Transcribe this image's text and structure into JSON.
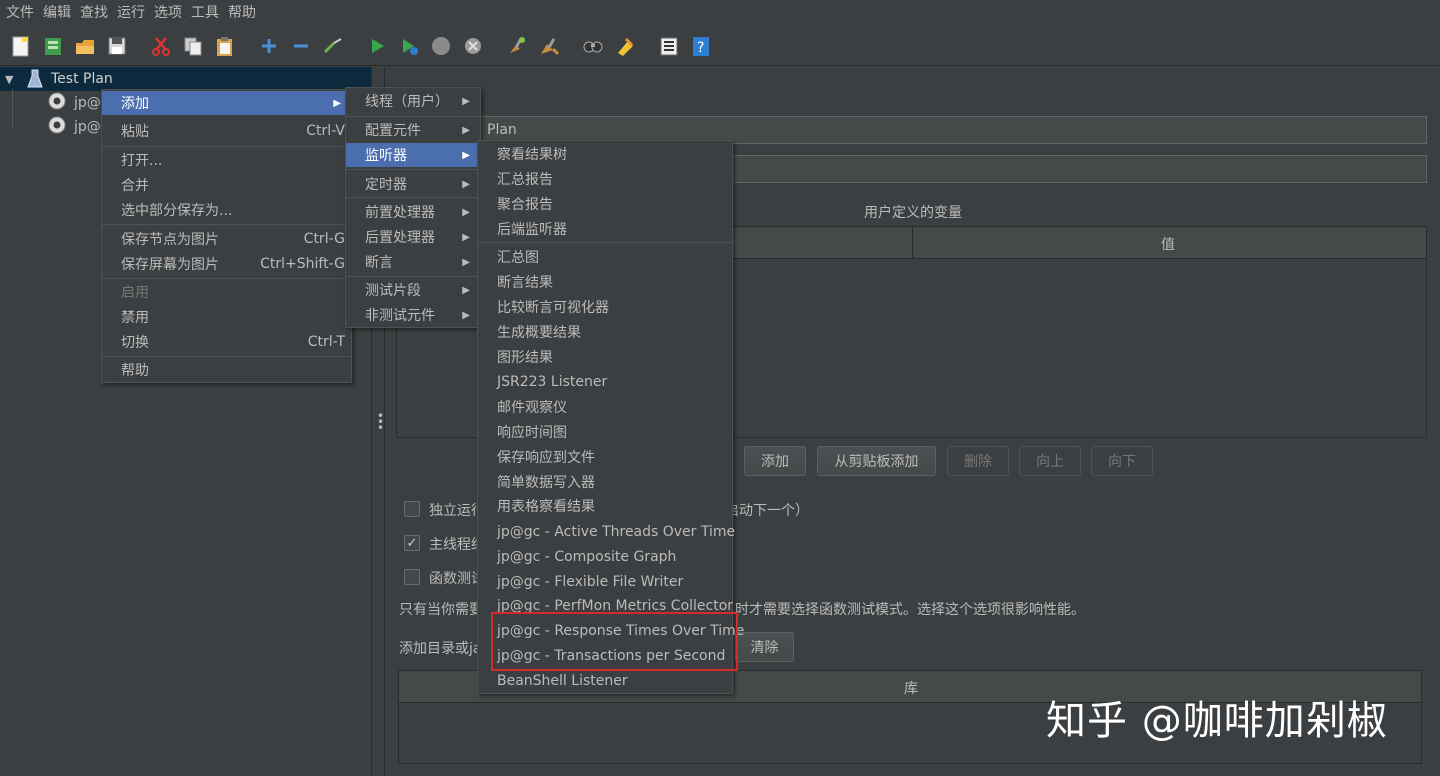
{
  "menubar": [
    "文件",
    "编辑",
    "查找",
    "运行",
    "选项",
    "工具",
    "帮助"
  ],
  "toolbar_icons": [
    "new-icon",
    "templates-icon",
    "open-icon",
    "save-icon",
    "cut-icon",
    "copy-icon",
    "paste-icon",
    "expand-icon",
    "collapse-icon",
    "toggle-icon",
    "start-icon",
    "start-no-pause-icon",
    "stop-icon",
    "shutdown-icon",
    "clear-icon",
    "clear-all-icon",
    "search-icon",
    "reset-search-icon",
    "function-helper-icon",
    "help-icon"
  ],
  "tree": {
    "root": "Test Plan",
    "children": [
      "jp@",
      "jp@"
    ]
  },
  "context_menu": {
    "items": [
      {
        "label": "添加",
        "shortcut": ""
      },
      {
        "label": "粘贴",
        "shortcut": "Ctrl-V"
      },
      {
        "label": "打开...",
        "shortcut": ""
      },
      {
        "label": "合并",
        "shortcut": ""
      },
      {
        "label": "选中部分保存为...",
        "shortcut": ""
      },
      {
        "label": "保存节点为图片",
        "shortcut": "Ctrl-G"
      },
      {
        "label": "保存屏幕为图片",
        "shortcut": "Ctrl+Shift-G"
      },
      {
        "label": "启用",
        "shortcut": ""
      },
      {
        "label": "禁用",
        "shortcut": ""
      },
      {
        "label": "切换",
        "shortcut": "Ctrl-T"
      },
      {
        "label": "帮助",
        "shortcut": ""
      }
    ]
  },
  "add_submenu": {
    "items": [
      "线程（用户）",
      "配置元件",
      "监听器",
      "定时器",
      "前置处理器",
      "后置处理器",
      "断言",
      "测试片段",
      "非测试元件"
    ]
  },
  "listener_submenu": {
    "items": [
      "察看结果树",
      "汇总报告",
      "聚合报告",
      "后端监听器",
      "汇总图",
      "断言结果",
      "比较断言可视化器",
      "生成概要结果",
      "图形结果",
      "JSR223 Listener",
      "邮件观察仪",
      "响应时间图",
      "保存响应到文件",
      "简单数据写入器",
      "用表格察看结果",
      "jp@gc - Active Threads Over Time",
      "jp@gc - Composite Graph",
      "jp@gc - Flexible File Writer",
      "jp@gc - PerfMon Metrics Collector",
      "jp@gc - Response Times Over Time",
      "jp@gc - Transactions per Second",
      "BeanShell Listener"
    ]
  },
  "main": {
    "name_value": "Plan",
    "comment_value": "",
    "vars_title": "用户定义的变量",
    "col_value": "值",
    "buttons": {
      "add": "添加",
      "add_clipboard": "从剪贴板添加",
      "delete": "删除",
      "up": "向上",
      "down": "向下"
    },
    "chk1": "独立运行",
    "chk1_tail": "启动下一个）",
    "chk2": "主线程结",
    "chk3": "函数测试",
    "note_left": "只有当你需要",
    "note_right": "时才需要选择函数测试模式。选择这个选项很影响性能。",
    "classpath_label": "添加目录或ja",
    "clear": "清除",
    "lib_header": "库"
  },
  "watermark": "知乎 @咖啡加剁椒"
}
